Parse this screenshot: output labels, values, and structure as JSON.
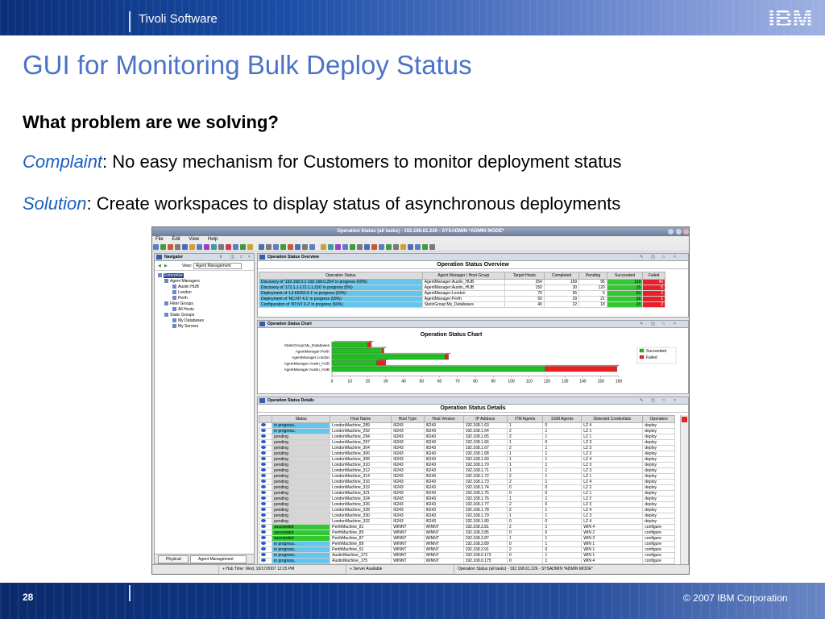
{
  "banner": {
    "brand": "Tivoli Software",
    "logo": "IBM"
  },
  "slide": {
    "title": "GUI for Monitoring Bulk Deploy Status",
    "problem": "What problem are we solving?",
    "complaint_label": "Complaint",
    "complaint_text": ":  No easy mechanism for Customers to monitor deployment status",
    "solution_label": "Solution",
    "solution_text": ": Create workspaces to display status of asynchronous deployments"
  },
  "window": {
    "title": "Operation Status (all tasks) - 192.168.61.226 - SYSADMIN   *ADMIN MODE*",
    "menu": [
      "File",
      "Edit",
      "View",
      "Help"
    ]
  },
  "navigator": {
    "title": "Navigator",
    "view_label": "View:",
    "view_value": "Agent Management",
    "tree": [
      "Enterprise",
      "Agent Managers",
      "Austin HUB",
      "London",
      "Perth",
      "Filter Groups",
      "All Hosts",
      "Static Groups",
      "My Databases",
      "My Servers"
    ],
    "tabs": [
      "Physical",
      "Agent Management"
    ]
  },
  "overview": {
    "pane_title": "Operation Status Overview",
    "table_title": "Operation Status Overview",
    "columns": [
      "Operation Status",
      "Agent Manager / Host Group",
      "Target Hosts",
      "Completed",
      "Pending",
      "Succeeded",
      "Failed"
    ],
    "rows": [
      [
        "Discovery of '192.168.0.1-192.168.0.254' in progress (60%)",
        "AgentManager:Austin_HUB",
        "254",
        "159",
        "95",
        "119",
        "40"
      ],
      [
        "Discovery of '172.1.1-172.1.1.150' in progress (5%)",
        "AgentManager:Austin_HUB",
        "150",
        "30",
        "120",
        "25",
        "5"
      ],
      [
        "Deployment of 'LZ:65263.6.1' in progress (93%)",
        "AgentManager:London",
        "70",
        "65",
        "5",
        "63",
        "2"
      ],
      [
        "Deployment of 'NC:NT 4.1' in progress (58%)",
        "AgentManager:Perth",
        "50",
        "29",
        "21",
        "28",
        "1"
      ],
      [
        "Configuration of 'NT:NT 6.2' in progress (50%)",
        "StaticGroup:My_Databases",
        "40",
        "22",
        "18",
        "20",
        "2"
      ]
    ]
  },
  "chart_pane": {
    "pane_title": "Operation Status Chart"
  },
  "chart_data": {
    "type": "bar",
    "orientation": "horizontal",
    "stacked": true,
    "title": "Operation Status Chart",
    "categories": [
      "StaticGroup:My_Databases",
      "AgentManager:Perth",
      "AgentManager:London",
      "AgentManager:Austin_HUB",
      "AgentManager:Austin_HUB"
    ],
    "series": [
      {
        "name": "Succeeded",
        "color": "#20c020",
        "values": [
          20,
          28,
          63,
          25,
          119
        ]
      },
      {
        "name": "Failed",
        "color": "#e82020",
        "values": [
          2,
          1,
          2,
          5,
          40
        ]
      }
    ],
    "xlim": [
      0,
      160
    ],
    "xticks": [
      0,
      10,
      20,
      30,
      40,
      50,
      60,
      70,
      80,
      90,
      100,
      110,
      120,
      130,
      140,
      150,
      160
    ],
    "legend": "right"
  },
  "details": {
    "pane_title": "Operation Status Details",
    "table_title": "Operation Status Details",
    "columns": [
      "",
      "Status",
      "Host Name",
      "Host Type",
      "Host Version",
      "IP Address",
      "ITM Agents",
      "SSM Agents",
      "Detected Credentials",
      "Operation"
    ],
    "rows": [
      [
        "in progress..",
        "LondonMachine_289",
        "I6243",
        "I6243",
        "192.168.1.63",
        "1",
        "0",
        "LZ 4",
        "deploy"
      ],
      [
        "in progress..",
        "LondonMachine_292",
        "I6243",
        "I6243",
        "192.168.1.64",
        "2",
        "1",
        "LZ 1",
        "deploy"
      ],
      [
        "pending",
        "LondonMachine_294",
        "I6243",
        "I6243",
        "192.168.1.65",
        "2",
        "1",
        "LZ 1",
        "deploy"
      ],
      [
        "pending",
        "LondonMachine_297",
        "I6243",
        "I6243",
        "192.168.1.66",
        "1",
        "0",
        "LZ 3",
        "deploy"
      ],
      [
        "pending",
        "LondonMachine_304",
        "I6243",
        "I6243",
        "192.168.1.67",
        "2",
        "1",
        "LZ 3",
        "deploy"
      ],
      [
        "pending",
        "LondonMachine_306",
        "I6243",
        "I6243",
        "192.168.1.68",
        "1",
        "1",
        "LZ 3",
        "deploy"
      ],
      [
        "pending",
        "LondonMachine_308",
        "I6243",
        "I6243",
        "192.168.1.69",
        "1",
        "1",
        "LZ 4",
        "deploy"
      ],
      [
        "pending",
        "LondonMachine_310",
        "I6243",
        "I6243",
        "192.168.1.70",
        "1",
        "1",
        "LZ 3",
        "deploy"
      ],
      [
        "pending",
        "LondonMachine_312",
        "I6243",
        "I6243",
        "192.168.1.71",
        "1",
        "1",
        "LZ 3",
        "deploy"
      ],
      [
        "pending",
        "LondonMachine_314",
        "I6243",
        "I6243",
        "192.168.1.72",
        "2",
        "1",
        "LZ 1",
        "deploy"
      ],
      [
        "pending",
        "LondonMachine_316",
        "I6243",
        "I6243",
        "192.168.1.73",
        "2",
        "1",
        "LZ 4",
        "deploy"
      ],
      [
        "pending",
        "LondonMachine_319",
        "I6243",
        "I6243",
        "192.168.1.74",
        "0",
        "0",
        "LZ 2",
        "deploy"
      ],
      [
        "pending",
        "LondonMachine_321",
        "I6243",
        "I6243",
        "192.168.1.75",
        "0",
        "0",
        "LZ 1",
        "deploy"
      ],
      [
        "pending",
        "LondonMachine_324",
        "I6243",
        "I6243",
        "192.168.1.76",
        "1",
        "1",
        "LZ 2",
        "deploy"
      ],
      [
        "pending",
        "LondonMachine_326",
        "I6243",
        "I6243",
        "192.168.1.77",
        "2",
        "0",
        "LZ 3",
        "deploy"
      ],
      [
        "pending",
        "LondonMachine_328",
        "I6243",
        "I6243",
        "192.168.1.78",
        "2",
        "1",
        "LZ 4",
        "deploy"
      ],
      [
        "pending",
        "LondonMachine_330",
        "I6243",
        "I6243",
        "192.168.1.79",
        "1",
        "1",
        "LZ 3",
        "deploy"
      ],
      [
        "pending",
        "LondonMachine_332",
        "I6243",
        "I6243",
        "192.168.1.80",
        "0",
        "0",
        "LZ 4",
        "deploy"
      ],
      [
        "succeeded",
        "PerthMachine_81",
        "WINNT",
        "WINNT",
        "192.168.3.81",
        "2",
        "1",
        "WIN 4",
        "configure"
      ],
      [
        "succeeded",
        "PerthMachine_85",
        "WINNT",
        "WINNT",
        "192.168.3.85",
        "0",
        "0",
        "WIN 2",
        "configure"
      ],
      [
        "succeeded",
        "PerthMachine_87",
        "WINNT",
        "WINNT",
        "192.168.3.87",
        "1",
        "1",
        "WIN 3",
        "configure"
      ],
      [
        "in progress..",
        "PerthMachine_89",
        "WINNT",
        "WINNT",
        "192.168.3.89",
        "0",
        "1",
        "WIN 1",
        "configure"
      ],
      [
        "in progress..",
        "PerthMachine_91",
        "WINNT",
        "WINNT",
        "192.168.3.91",
        "2",
        "0",
        "WIN 1",
        "configure"
      ],
      [
        "in progress..",
        "AustinMachine_173",
        "WINNT",
        "WINNT",
        "192.168.0.173",
        "0",
        "1",
        "WIN 1",
        "configure"
      ],
      [
        "in progress..",
        "AustinMachine_175",
        "WINNT",
        "WINNT",
        "192.168.0.175",
        "0",
        "1",
        "WIN 4",
        "configure"
      ]
    ]
  },
  "statusbar": {
    "hub_time": "Hub Time: Wed, 10/17/2007 12:25 PM",
    "server": "Server Available",
    "window": "Operation Status (all tasks) - 192.168.61.226 - SYSADMIN   *ADMIN MODE*"
  },
  "footer": {
    "page": "28",
    "copyright": "© 2007 IBM Corporation"
  },
  "colors": {
    "accent": "#4a73c8",
    "status_blue": "#63c6ee",
    "succeeded_green": "#32c832",
    "failed_red": "#e8202a",
    "pending_grey": "#d6d6d6"
  }
}
